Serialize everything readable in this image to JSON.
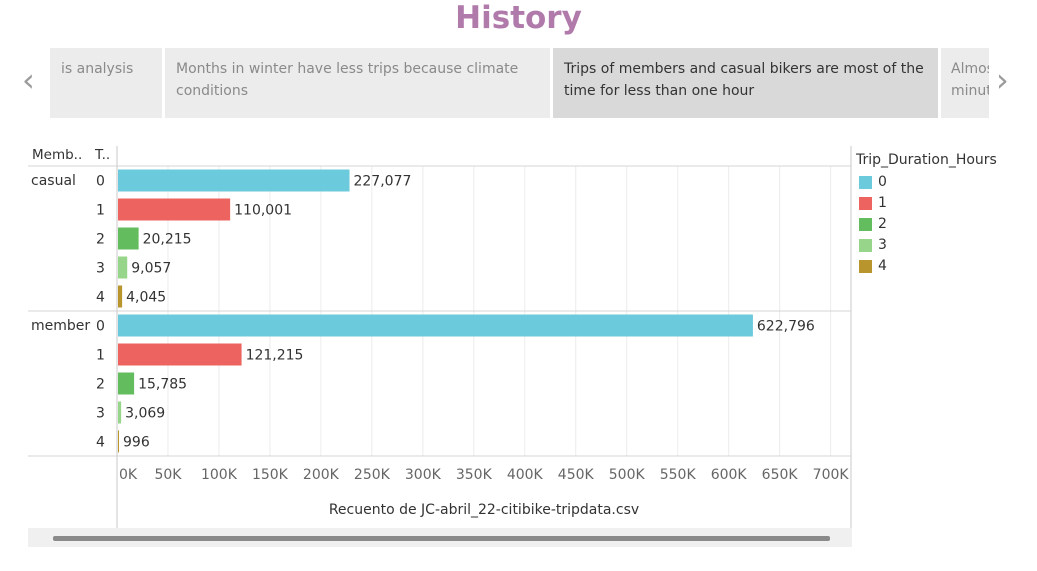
{
  "page_title": "History",
  "story_points": [
    {
      "text": "is analysis",
      "active": false
    },
    {
      "text": "Months in winter have less trips because climate conditions",
      "active": false
    },
    {
      "text": "Trips of members and casual bikers are most of the time for less than one hour",
      "active": true
    },
    {
      "text": "Almost\nminute",
      "active": false
    }
  ],
  "nav": {
    "prev_symbol": "‹",
    "next_symbol": "›"
  },
  "chart_data": {
    "type": "bar",
    "orientation": "horizontal",
    "row_headers": [
      "Memb..",
      "T.."
    ],
    "groups": [
      {
        "name": "casual",
        "bars": [
          {
            "duration": "0",
            "value": 227077,
            "label": "227,077"
          },
          {
            "duration": "1",
            "value": 110001,
            "label": "110,001"
          },
          {
            "duration": "2",
            "value": 20215,
            "label": "20,215"
          },
          {
            "duration": "3",
            "value": 9057,
            "label": "9,057"
          },
          {
            "duration": "4",
            "value": 4045,
            "label": "4,045"
          }
        ]
      },
      {
        "name": "member",
        "bars": [
          {
            "duration": "0",
            "value": 622796,
            "label": "622,796"
          },
          {
            "duration": "1",
            "value": 121215,
            "label": "121,215"
          },
          {
            "duration": "2",
            "value": 15785,
            "label": "15,785"
          },
          {
            "duration": "3",
            "value": 3069,
            "label": "3,069"
          },
          {
            "duration": "4",
            "value": 996,
            "label": "996"
          }
        ]
      }
    ],
    "x_ticks": [
      {
        "value": 0,
        "label": "0K"
      },
      {
        "value": 50000,
        "label": "50K"
      },
      {
        "value": 100000,
        "label": "100K"
      },
      {
        "value": 150000,
        "label": "150K"
      },
      {
        "value": 200000,
        "label": "200K"
      },
      {
        "value": 250000,
        "label": "250K"
      },
      {
        "value": 300000,
        "label": "300K"
      },
      {
        "value": 350000,
        "label": "350K"
      },
      {
        "value": 400000,
        "label": "400K"
      },
      {
        "value": 450000,
        "label": "450K"
      },
      {
        "value": 500000,
        "label": "500K"
      },
      {
        "value": 550000,
        "label": "550K"
      },
      {
        "value": 600000,
        "label": "600K"
      },
      {
        "value": 650000,
        "label": "650K"
      },
      {
        "value": 700000,
        "label": "700K"
      }
    ],
    "xlim": [
      0,
      720000
    ],
    "xlabel": "Recuento de JC-abril_22-citibike-tripdata.csv",
    "grid": true,
    "legend": {
      "title": "Trip_Duration_Hours",
      "placement": "right",
      "items": [
        {
          "label": "0",
          "color": "#6bcadb"
        },
        {
          "label": "1",
          "color": "#ec635f"
        },
        {
          "label": "2",
          "color": "#63bd5e"
        },
        {
          "label": "3",
          "color": "#97d58b"
        },
        {
          "label": "4",
          "color": "#b8952d"
        }
      ]
    }
  }
}
